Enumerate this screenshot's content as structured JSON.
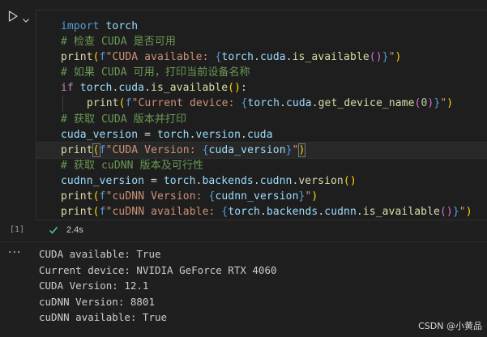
{
  "cell": {
    "execution_count": "[1]",
    "status_duration": "2.4s",
    "code_lines": [
      "import torch",
      "# 检查 CUDA 是否可用",
      "print(f\"CUDA available: {torch.cuda.is_available()}\")",
      "# 如果 CUDA 可用，打印当前设备名称",
      "if torch.cuda.is_available():",
      "    print(f\"Current device: {torch.cuda.get_device_name(0)}\")",
      "# 获取 CUDA 版本并打印",
      "cuda_version = torch.version.cuda",
      "print(f\"CUDA Version: {cuda_version}\")",
      "# 获取 cuDNN 版本及可行性",
      "cudnn_version = torch.backends.cudnn.version()",
      "print(f\"cuDNN Version: {cudnn_version}\")",
      "print(f\"cuDNN available: {torch.backends.cudnn.is_available()}\")"
    ]
  },
  "output": {
    "menu_label": "···",
    "lines": [
      "CUDA available: True",
      "Current device: NVIDIA GeForce RTX 4060",
      "CUDA Version: 12.1",
      "cuDNN Version: 8801",
      "cuDNN available: True"
    ]
  },
  "watermark": "CSDN @小黄品",
  "icons": {
    "run": "play-icon",
    "run_menu": "chevron-down-icon",
    "status": "check-icon"
  },
  "colors": {
    "background": "#1f1f1f",
    "editor_background": "#1e1e1e",
    "keyword": "#569cd6",
    "control": "#c586c0",
    "comment": "#6a9955",
    "function": "#dcdcaa",
    "string": "#ce9178",
    "variable": "#9cdcfe",
    "number": "#b5cea8",
    "success": "#4ec9b0"
  }
}
